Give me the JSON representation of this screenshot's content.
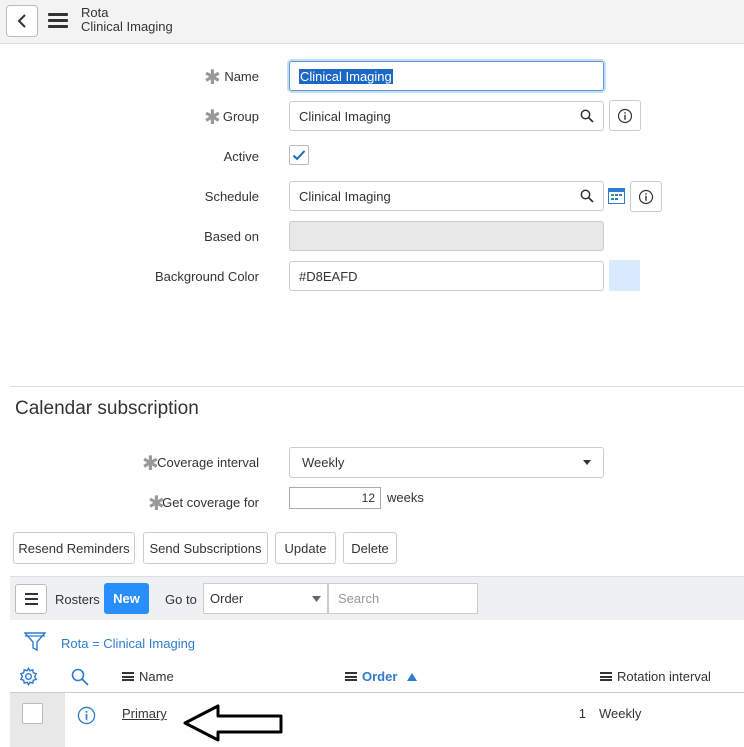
{
  "header": {
    "title": "Rota",
    "subtitle": "Clinical Imaging"
  },
  "form": {
    "name_label": "Name",
    "name_value": "Clinical Imaging",
    "group_label": "Group",
    "group_value": "Clinical Imaging",
    "active_label": "Active",
    "active_checked": true,
    "schedule_label": "Schedule",
    "schedule_value": "Clinical Imaging",
    "based_on_label": "Based on",
    "based_on_value": "",
    "bgcolor_label": "Background Color",
    "bgcolor_value": "#D8EAFD"
  },
  "calendar": {
    "title": "Calendar subscription",
    "coverage_label": "Coverage interval",
    "coverage_value": "Weekly",
    "get_coverage_label": "Get coverage for",
    "get_coverage_value": "12",
    "get_coverage_unit": "weeks"
  },
  "actions": {
    "resend": "Resend Reminders",
    "send": "Send Subscriptions",
    "update": "Update",
    "delete": "Delete"
  },
  "related_list": {
    "label": "Rosters",
    "new_label": "New",
    "goto_label": "Go to",
    "goto_select": "Order",
    "search_placeholder": "Search",
    "filter": "Rota = Clinical Imaging",
    "columns": {
      "name": "Name",
      "order": "Order",
      "rotation": "Rotation interval"
    },
    "rows": [
      {
        "name": "Primary",
        "order": "1",
        "rotation": "Weekly"
      }
    ]
  },
  "colors": {
    "accent": "#278efc",
    "link": "#2e7bcf",
    "swatch": "#D8EAFD"
  }
}
